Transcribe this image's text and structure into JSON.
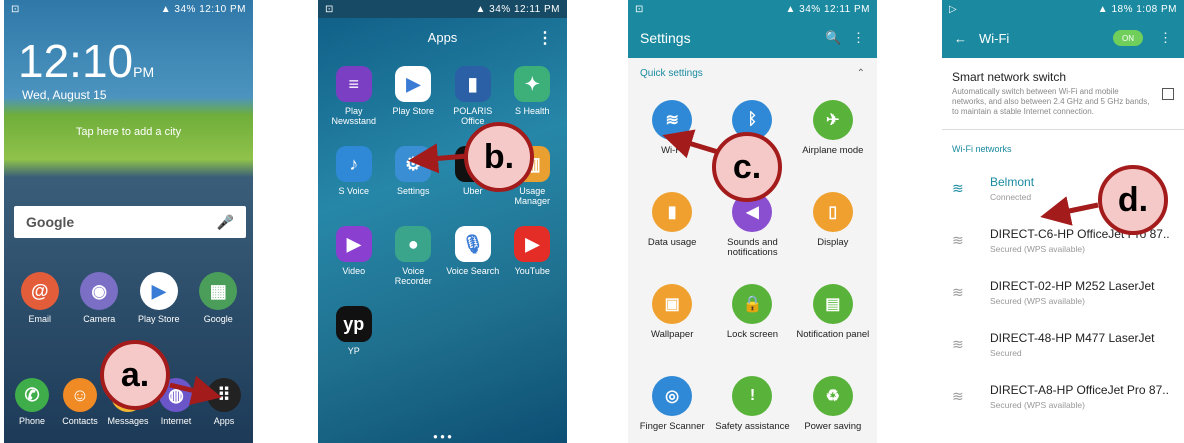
{
  "status_bars": [
    {
      "time": "12:10 PM",
      "battery": "34%"
    },
    {
      "time": "12:11 PM",
      "battery": "34%"
    },
    {
      "time": "12:11 PM",
      "battery": "34%"
    },
    {
      "time": "1:08 PM",
      "battery": "18%"
    }
  ],
  "lockscreen": {
    "clock": "12:10",
    "ampm": "PM",
    "date": "Wed, August 15",
    "city_hint": "Tap here to add a city",
    "search_logo": "Google",
    "home_apps": [
      {
        "label": "Email",
        "color": "#e35d3a",
        "icon": "email-icon",
        "glyph": "@"
      },
      {
        "label": "Camera",
        "color": "#7a6fc5",
        "icon": "camera-icon",
        "glyph": "◉"
      },
      {
        "label": "Play Store",
        "color": "#ffffff",
        "icon": "play-store-icon",
        "glyph": "▶"
      },
      {
        "label": "Google",
        "color": "#4a9e5a",
        "icon": "google-folder-icon",
        "glyph": "▦"
      }
    ],
    "dock": [
      {
        "label": "Phone",
        "color": "#3fae4a",
        "icon": "phone-icon",
        "glyph": "✆"
      },
      {
        "label": "Contacts",
        "color": "#f08a24",
        "icon": "contacts-icon",
        "glyph": "☺"
      },
      {
        "label": "Messages",
        "color": "#f2b833",
        "icon": "messages-icon",
        "glyph": "✉"
      },
      {
        "label": "Internet",
        "color": "#6b56c9",
        "icon": "internet-icon",
        "glyph": "◍"
      },
      {
        "label": "Apps",
        "color": "#222222",
        "icon": "apps-grid-icon",
        "glyph": "⠿"
      }
    ]
  },
  "apps_drawer": {
    "title": "Apps",
    "apps": [
      {
        "label": "Play Newsstand",
        "color": "#7b3fc4",
        "icon": "newsstand-icon",
        "glyph": "≡"
      },
      {
        "label": "Play Store",
        "color": "#ffffff",
        "icon": "play-store-icon",
        "glyph": "▶"
      },
      {
        "label": "POLARIS Office",
        "color": "#2b5fa6",
        "icon": "polaris-office-icon",
        "glyph": "▮"
      },
      {
        "label": "S Health",
        "color": "#3db07a",
        "icon": "s-health-icon",
        "glyph": "✦"
      },
      {
        "label": "S Voice",
        "color": "#2f89d6",
        "icon": "s-voice-icon",
        "glyph": "♪"
      },
      {
        "label": "Settings",
        "color": "#3a8fd4",
        "icon": "settings-gear-icon",
        "glyph": "⚙"
      },
      {
        "label": "Uber",
        "color": "#111111",
        "icon": "uber-icon",
        "glyph": "U"
      },
      {
        "label": "Usage Manager",
        "color": "#e9a030",
        "icon": "usage-manager-icon",
        "glyph": "▥"
      },
      {
        "label": "Video",
        "color": "#8a3fd0",
        "icon": "video-icon",
        "glyph": "▶"
      },
      {
        "label": "Voice Recorder",
        "color": "#3aa58a",
        "icon": "voice-recorder-icon",
        "glyph": "●"
      },
      {
        "label": "Voice Search",
        "color": "#ffffff",
        "icon": "voice-search-icon",
        "glyph": "🎙"
      },
      {
        "label": "YouTube",
        "color": "#e52d27",
        "icon": "youtube-icon",
        "glyph": "▶"
      },
      {
        "label": "YP",
        "color": "#111111",
        "icon": "yp-icon",
        "glyph": "yp"
      }
    ]
  },
  "settings": {
    "title": "Settings",
    "section": "Quick settings",
    "tiles": [
      {
        "label": "Wi-Fi",
        "color": "#2f89d6",
        "icon": "wifi-icon",
        "glyph": "≋"
      },
      {
        "label": "Bluetooth",
        "color": "#2f89d6",
        "icon": "bluetooth-icon",
        "glyph": "ᛒ"
      },
      {
        "label": "Airplane mode",
        "color": "#59b33a",
        "icon": "airplane-icon",
        "glyph": "✈"
      },
      {
        "label": "Data usage",
        "color": "#f0a02e",
        "icon": "data-usage-icon",
        "glyph": "▮"
      },
      {
        "label": "Sounds and notifications",
        "color": "#8a4fd0",
        "icon": "sound-icon",
        "glyph": "◀"
      },
      {
        "label": "Display",
        "color": "#f0a02e",
        "icon": "display-icon",
        "glyph": "▯"
      },
      {
        "label": "Wallpaper",
        "color": "#f0a02e",
        "icon": "wallpaper-icon",
        "glyph": "▣"
      },
      {
        "label": "Lock screen",
        "color": "#59b33a",
        "icon": "lock-screen-icon",
        "glyph": "🔒"
      },
      {
        "label": "Notification panel",
        "color": "#59b33a",
        "icon": "notification-panel-icon",
        "glyph": "▤"
      },
      {
        "label": "Finger Scanner",
        "color": "#2f89d6",
        "icon": "fingerprint-icon",
        "glyph": "◎"
      },
      {
        "label": "Safety assistance",
        "color": "#59b33a",
        "icon": "safety-icon",
        "glyph": "!"
      },
      {
        "label": "Power saving",
        "color": "#59b33a",
        "icon": "power-saving-icon",
        "glyph": "♻"
      }
    ]
  },
  "wifi": {
    "title": "Wi-Fi",
    "toggle": "ON",
    "smart_switch": {
      "title": "Smart network switch",
      "desc": "Automatically switch between Wi-Fi and mobile networks, and also between 2.4 GHz and 5 GHz bands, to maintain a stable Internet connection."
    },
    "section": "Wi-Fi networks",
    "networks": [
      {
        "name": "Belmont",
        "status": "Connected"
      },
      {
        "name": "DIRECT-C6-HP OfficeJet Pro 87..",
        "status": "Secured (WPS available)"
      },
      {
        "name": "DIRECT-02-HP M252 LaserJet",
        "status": "Secured (WPS available)"
      },
      {
        "name": "DIRECT-48-HP M477 LaserJet",
        "status": "Secured"
      },
      {
        "name": "DIRECT-A8-HP OfficeJet Pro 87..",
        "status": "Secured (WPS available)"
      }
    ]
  },
  "callouts": [
    "a.",
    "b.",
    "c.",
    "d."
  ],
  "callout_color": "#a31b1b"
}
